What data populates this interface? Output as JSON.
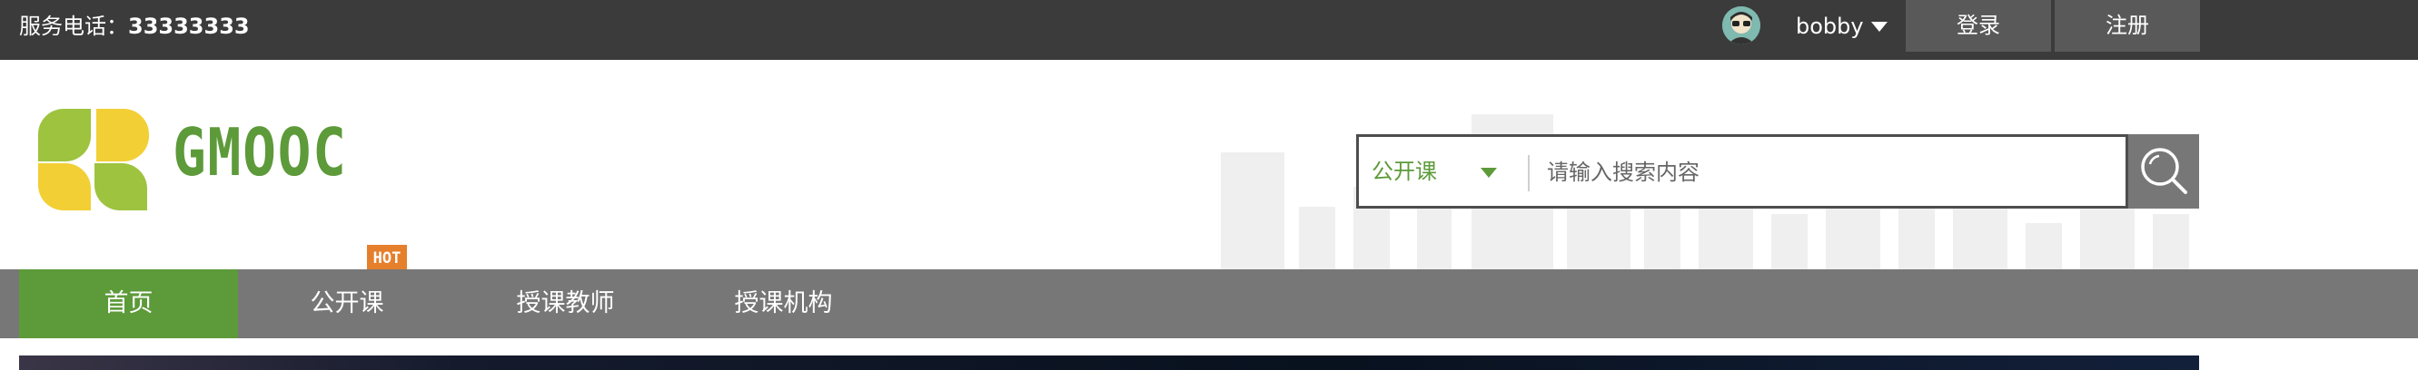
{
  "topbar": {
    "service_label": "服务电话：",
    "service_phone": "33333333",
    "username": "bobby",
    "login_label": "登录",
    "register_label": "注册"
  },
  "logo": {
    "text": "GMOOC"
  },
  "search": {
    "category": "公开课",
    "placeholder": "请输入搜索内容"
  },
  "nav": {
    "items": [
      {
        "label": "首页",
        "active": true
      },
      {
        "label": "公开课",
        "badge": "HOT"
      },
      {
        "label": "授课教师"
      },
      {
        "label": "授课机构"
      }
    ]
  },
  "colors": {
    "topbar_bg": "#3b3b3b",
    "brand_green": "#5d9a3a",
    "nav_bg": "#777777",
    "hot_orange": "#e57f2c",
    "annotation_red": "#d9302c"
  },
  "icons": [
    "user-avatar-icon",
    "chevron-down-icon",
    "search-icon",
    "logo-mark-icon"
  ]
}
